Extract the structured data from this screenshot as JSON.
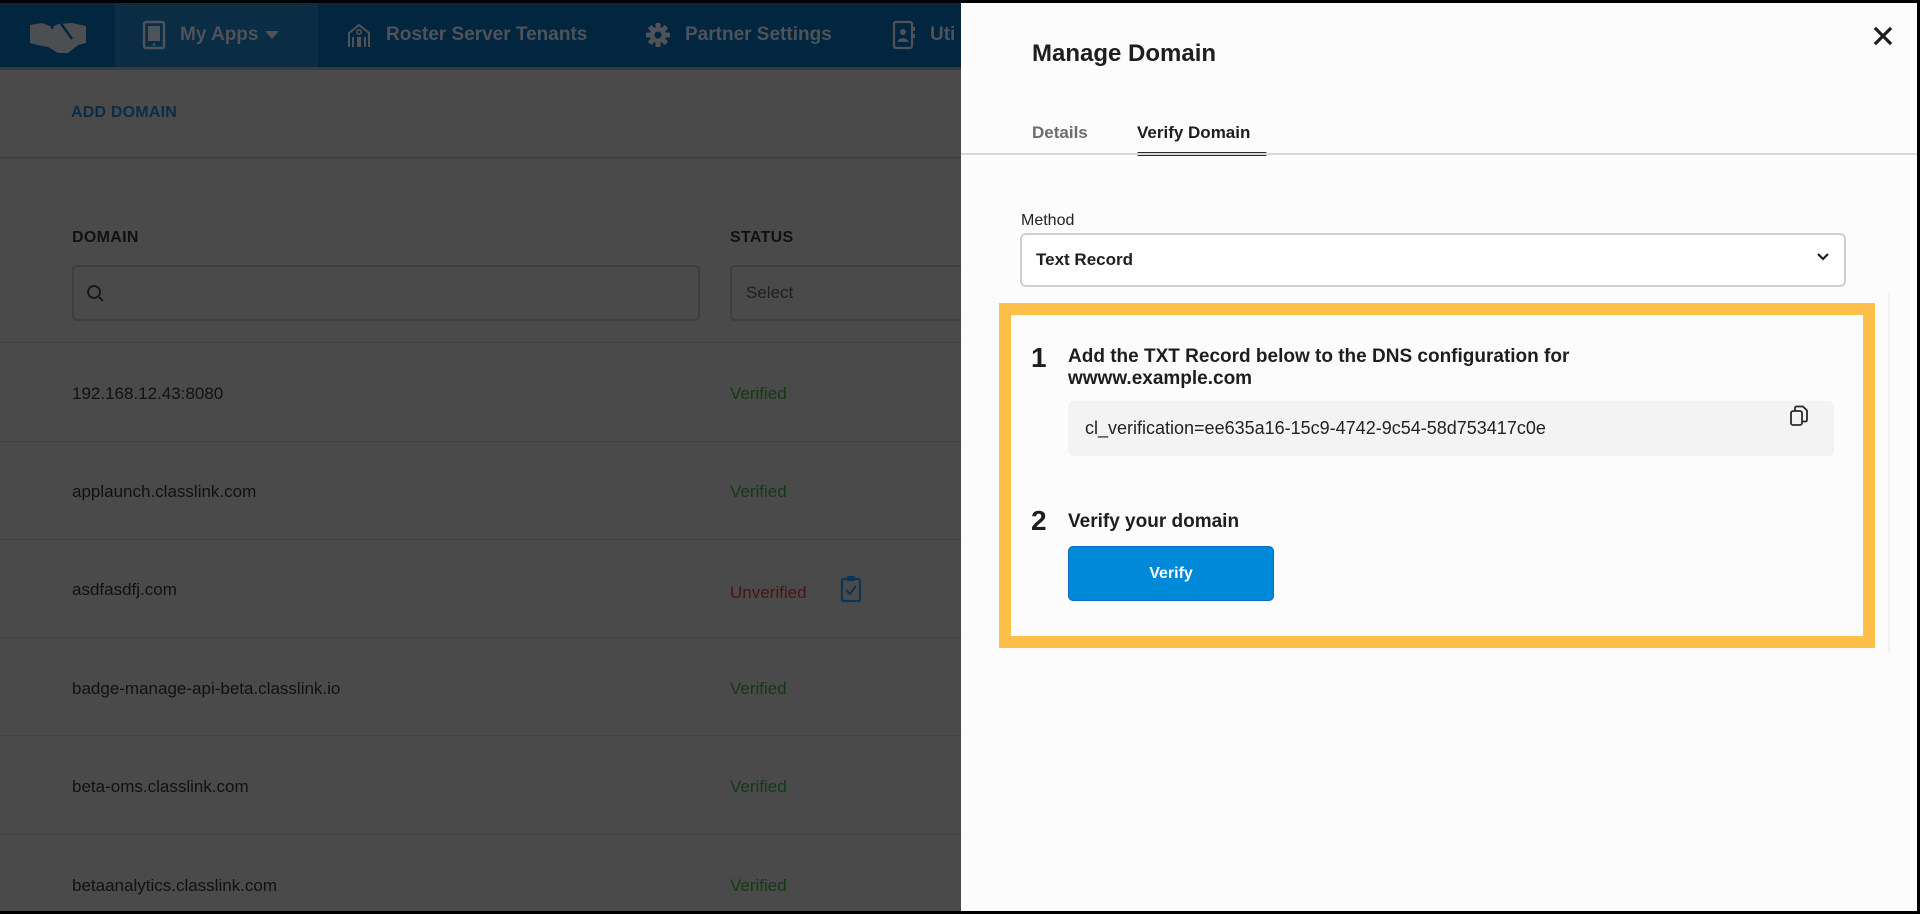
{
  "nav": {
    "logo_icon": "handshake-icon",
    "items": [
      {
        "label": "My Apps",
        "icon": "tablet-icon",
        "has_dropdown": true
      },
      {
        "label": "Roster Server Tenants",
        "icon": "building-icon"
      },
      {
        "label": "Partner Settings",
        "icon": "gear-icon"
      },
      {
        "label": "Uti",
        "icon": "contact-book-icon"
      }
    ]
  },
  "page": {
    "add_domain_label": "ADD DOMAIN",
    "columns": {
      "domain": "DOMAIN",
      "status": "STATUS"
    },
    "search": {
      "placeholder": "",
      "value": "",
      "icon": "search-icon"
    },
    "status_filter": {
      "value": "Select"
    },
    "rows": [
      {
        "domain": "192.168.12.43:8080",
        "status": "Verified"
      },
      {
        "domain": "applaunch.classlink.com",
        "status": "Verified"
      },
      {
        "domain": "asdfasdfj.com",
        "status": "Unverified",
        "action_icon": "clipboard-check-icon"
      },
      {
        "domain": "badge-manage-api-beta.classlink.io",
        "status": "Verified"
      },
      {
        "domain": "beta-oms.classlink.com",
        "status": "Verified"
      },
      {
        "domain": "betaanalytics.classlink.com",
        "status": "Verified"
      }
    ],
    "colors": {
      "verified": "#2e7d32",
      "unverified": "#b71c1c",
      "nav": "#0a4a7a"
    }
  },
  "panel": {
    "title": "Manage Domain",
    "close_icon": "close-icon",
    "tabs": [
      {
        "label": "Details",
        "active": false
      },
      {
        "label": "Verify Domain",
        "active": true
      }
    ],
    "method": {
      "label": "Method",
      "value": "Text Record"
    },
    "steps": [
      {
        "number": "1",
        "text_line1": "Add the TXT Record below to the DNS configuration for",
        "text_line2": "wwww.example.com",
        "record_value": "cl_verification=ee635a16-15c9-4742-9c54-58d753417c0e",
        "copy_icon": "copy-icon"
      },
      {
        "number": "2",
        "text": "Verify your domain",
        "button_label": "Verify"
      }
    ],
    "colors": {
      "highlight": "#fec04b",
      "primary_button": "#0088d9"
    }
  }
}
